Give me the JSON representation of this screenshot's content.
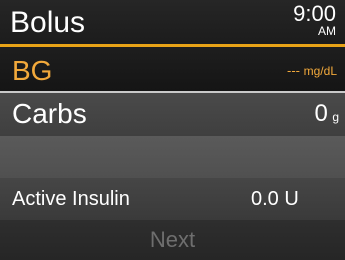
{
  "header": {
    "title": "Bolus",
    "time": "9:00",
    "ampm": "AM"
  },
  "bg": {
    "label": "BG",
    "value": "---",
    "unit": "mg/dL"
  },
  "carbs": {
    "label": "Carbs",
    "value": "0",
    "unit": "g"
  },
  "active_insulin": {
    "label": "Active Insulin",
    "value": "0.0 U"
  },
  "footer": {
    "next_label": "Next"
  },
  "colors": {
    "accent": "#e8a317",
    "highlight_text": "#f2a93b",
    "disabled_text": "#6e6e6e"
  }
}
